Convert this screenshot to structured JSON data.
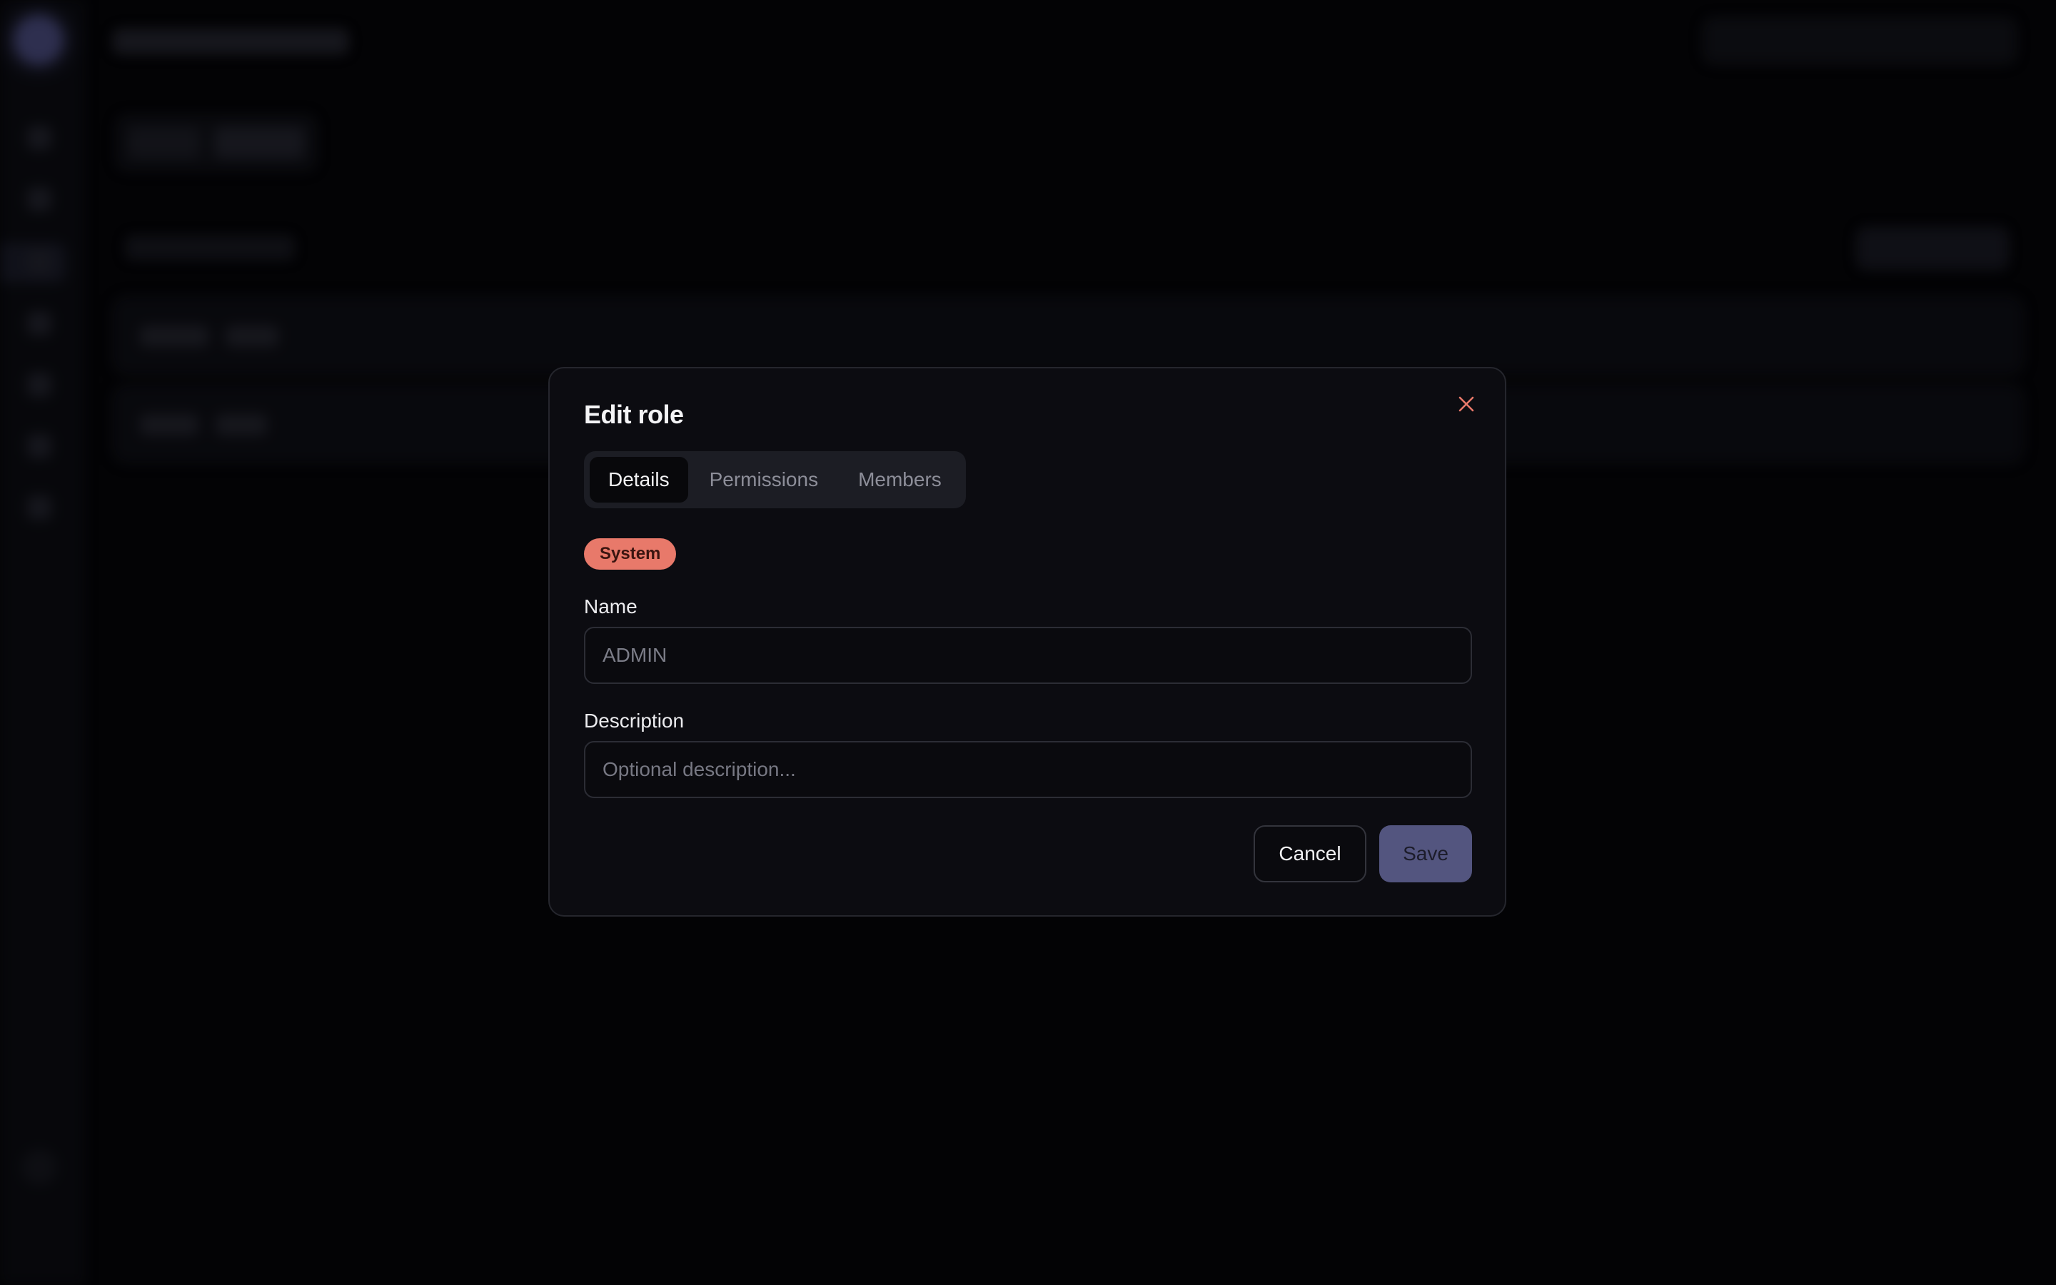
{
  "modal": {
    "title": "Edit role",
    "tabs": [
      {
        "label": "Details",
        "active": true
      },
      {
        "label": "Permissions",
        "active": false
      },
      {
        "label": "Members",
        "active": false
      }
    ],
    "badge": "System",
    "name_label": "Name",
    "name_value": "ADMIN",
    "description_label": "Description",
    "description_placeholder": "Optional description...",
    "cancel_label": "Cancel",
    "save_label": "Save"
  },
  "colors": {
    "accent": "#53557f",
    "badge": "#e8796a",
    "close_icon": "#e8796a"
  },
  "icons": {
    "close": "close-icon"
  }
}
